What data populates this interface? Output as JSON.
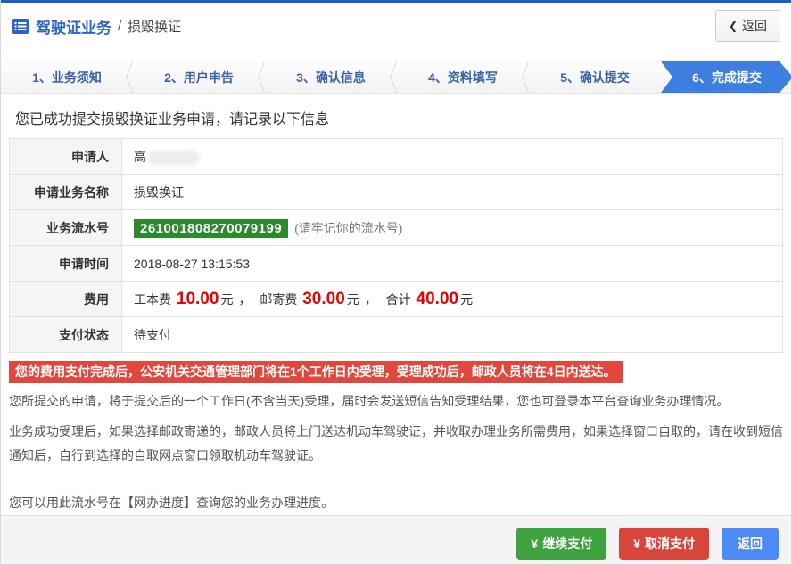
{
  "colors": {
    "topbar_blue": "#1e5fc1",
    "title_blue": "#2d64c8",
    "step_text_blue": "#3a62a7",
    "active_step_bg": "#3d7fe0",
    "serial_badge_green": "#2b8a2b",
    "fee_amount_red": "#ee0000",
    "warning_bg_red": "#e2473d",
    "button_green": "#3ea23e",
    "button_red": "#d9453b",
    "button_blue": "#4c8bf5"
  },
  "header": {
    "icon": "list-icon",
    "breadcrumb_main": "驾驶证业务",
    "breadcrumb_sep": "/",
    "breadcrumb_current": "损毁换证",
    "back_icon": "❮",
    "back_label": "返回"
  },
  "steps": {
    "items": [
      {
        "label": "1、业务须知",
        "active": false
      },
      {
        "label": "2、用户申告",
        "active": false
      },
      {
        "label": "3、确认信息",
        "active": false
      },
      {
        "label": "4、资料填写",
        "active": false
      },
      {
        "label": "5、确认提交",
        "active": false
      },
      {
        "label": "6、完成提交",
        "active": true
      }
    ]
  },
  "result": {
    "message": "您已成功提交损毁换证业务申请，请记录以下信息"
  },
  "info_table": {
    "applicant": {
      "label": "申请人",
      "value": "高"
    },
    "business_name": {
      "label": "申请业务名称",
      "value": "损毁换证"
    },
    "serial": {
      "label": "业务流水号",
      "number": "261001808270079199",
      "note": "(请牢记你的流水号)"
    },
    "apply_time": {
      "label": "申请时间",
      "value": "2018-08-27 13:15:53"
    },
    "fee": {
      "label": "费用",
      "cost_label": "工本费",
      "cost": "10.00",
      "unit": "元",
      "separator": "，",
      "postage_label": "邮寄费",
      "postage": "30.00",
      "total_label": "合计",
      "total": "40.00"
    },
    "pay_status": {
      "label": "支付状态",
      "value": "待支付"
    }
  },
  "notice": {
    "warning": "您的费用支付完成后，公安机关交通管理部门将在1个工作日内受理，受理成功后，邮政人员将在4日内送达。",
    "p1": "您所提交的申请，将于提交后的一个工作日(不含当天)受理，届时会发送短信告知受理结果，您也可登录本平台查询业务办理情况。",
    "p2": "业务成功受理后，如果选择邮政寄递的，邮政人员将上门送达机动车驾驶证，并收取办理业务所需费用，如果选择窗口自取的，请在收到短信通知后，自行到选择的自取网点窗口领取机动车驾驶证。",
    "p3": "您可以用此流水号在【网办进度】查询您的业务办理进度。"
  },
  "actions": {
    "currency": "¥",
    "continue_pay": "继续支付",
    "cancel_pay": "取消支付",
    "back": "返回"
  }
}
